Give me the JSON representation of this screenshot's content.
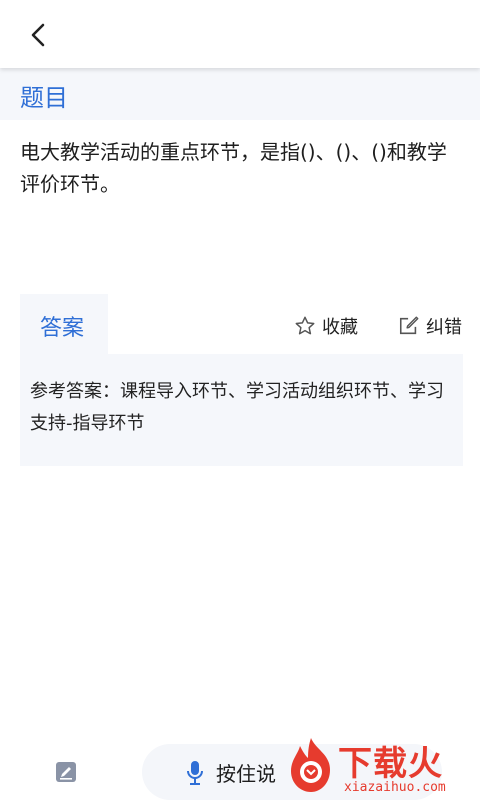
{
  "header": {
    "back_icon": "chevron-left-icon"
  },
  "section": {
    "title": "题目"
  },
  "question": {
    "text": "电大教学活动的重点环节，是指()、()、()和教学评价环节。"
  },
  "answer": {
    "tab_label": "答案",
    "favorite_label": "收藏",
    "favorite_icon": "star-outline-icon",
    "report_label": "纠错",
    "report_icon": "edit-square-icon",
    "text": "参考答案：课程导入环节、学习活动组织环节、学习支持-指导环节"
  },
  "bottom": {
    "edit_icon": "pencil-icon",
    "voice_label": "按住说",
    "mic_icon": "microphone-icon"
  },
  "watermark": {
    "brand": "下载火",
    "domain": "xiazaihuo.com",
    "accent": "#e63b2e"
  },
  "colors": {
    "accent": "#2f6fd6",
    "panel": "#f5f7fb"
  }
}
